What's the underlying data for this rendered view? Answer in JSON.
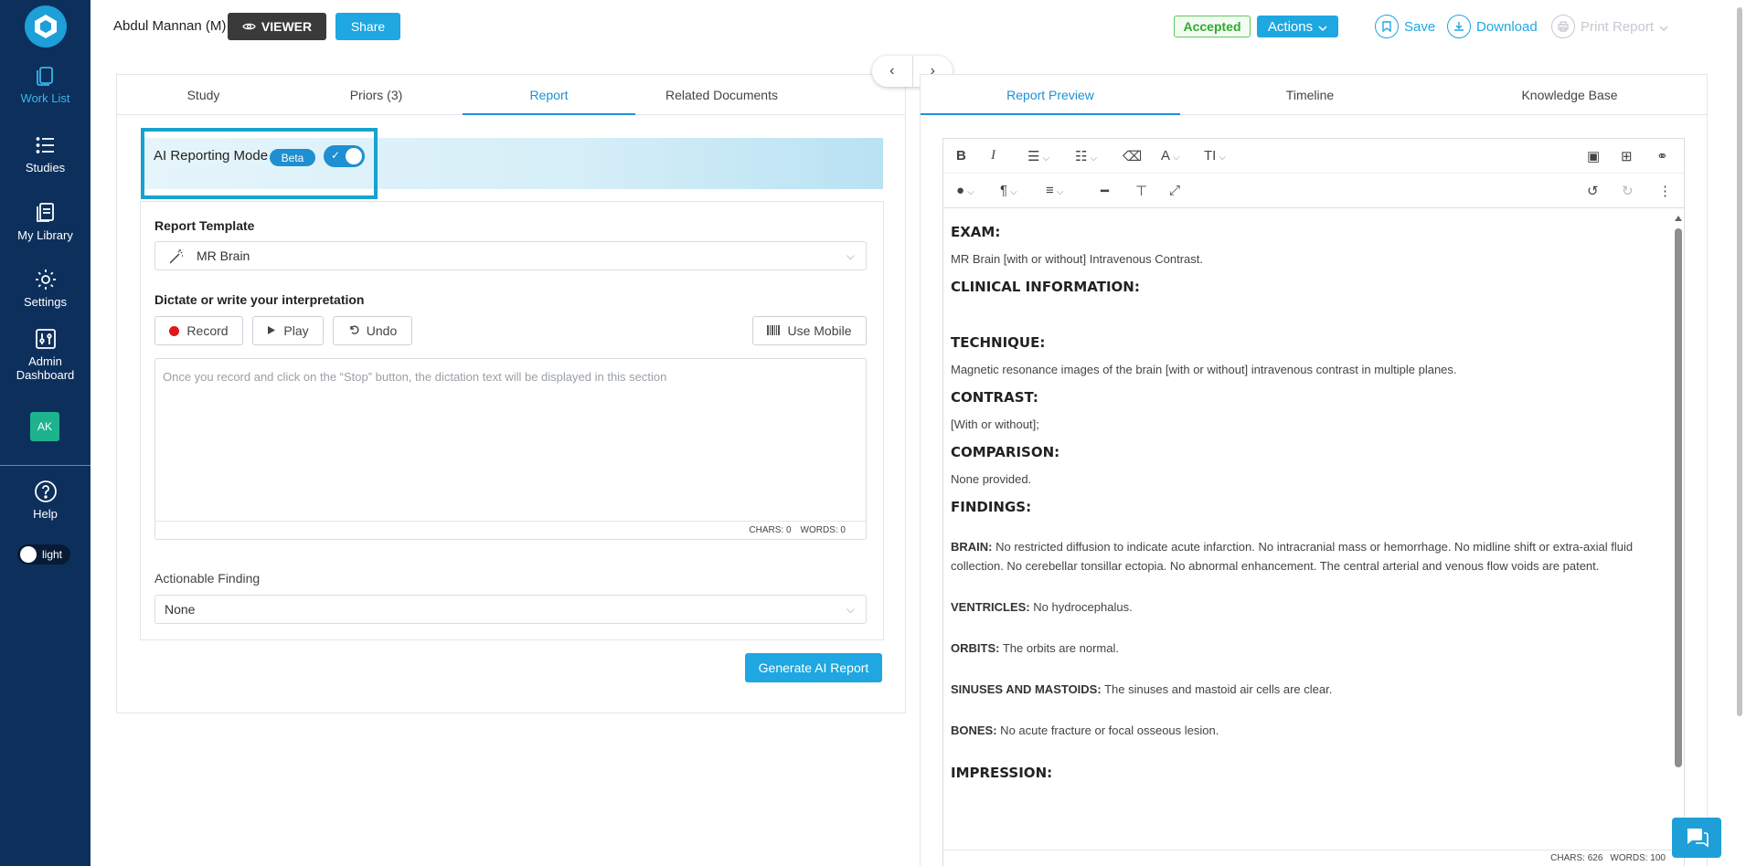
{
  "sidebar": {
    "items": [
      {
        "label": "Work List",
        "icon": "worklist-icon",
        "active": true
      },
      {
        "label": "Studies",
        "icon": "list-icon"
      },
      {
        "label": "My Library",
        "icon": "library-icon"
      },
      {
        "label": "Settings",
        "icon": "gear-icon"
      },
      {
        "label": "Admin Dashboard",
        "icon": "sliders-icon"
      }
    ],
    "avatar": "AK",
    "help": "Help",
    "theme": "light"
  },
  "header": {
    "patient": "Abdul Mannan (M)",
    "viewer": "VIEWER",
    "share": "Share",
    "status": "Accepted",
    "actions": "Actions",
    "save": "Save",
    "download": "Download",
    "print": "Print Report"
  },
  "left": {
    "tabs": [
      "Study",
      "Priors (3)",
      "Report",
      "Related Documents"
    ],
    "active_tab": "Report",
    "ai_label": "AI Reporting Mode",
    "beta": "Beta",
    "template_label": "Report Template",
    "template_value": "MR Brain",
    "dictate_label": "Dictate or write your interpretation",
    "record": "Record",
    "play": "Play",
    "undo": "Undo",
    "use_mobile": "Use Mobile",
    "placeholder": "Once you record and click on the “Stop” button, the dictation text will be displayed in this section",
    "chars": "CHARS: 0",
    "words": "WORDS: 0",
    "actionable_label": "Actionable Finding",
    "actionable_value": "None",
    "generate": "Generate AI Report"
  },
  "right": {
    "tabs": [
      "Report Preview",
      "Timeline",
      "Knowledge Base"
    ],
    "active_tab": "Report Preview",
    "report": {
      "exam_h": "EXAM:",
      "exam": "MR Brain [with or without] Intravenous Contrast.",
      "clinical_h": "CLINICAL INFORMATION:",
      "technique_h": "TECHNIQUE:",
      "technique": "Magnetic resonance images of the brain [with or without] intravenous contrast in multiple planes.",
      "contrast_h": "CONTRAST:",
      "contrast": "[With or without];",
      "comparison_h": "COMPARISON:",
      "comparison": "None provided.",
      "findings_h": "FINDINGS:",
      "brain_k": "BRAIN:",
      "brain": " No restricted diffusion to indicate acute infarction. No intracranial mass or hemorrhage. No midline shift or extra-axial fluid collection. No cerebellar tonsillar ectopia. No abnormal enhancement. The central arterial and venous flow voids are patent.",
      "ventricles_k": "VENTRICLES:",
      "ventricles": " No hydrocephalus.",
      "orbits_k": "ORBITS:",
      "orbits": " The orbits are normal.",
      "sinuses_k": "SINUSES AND MASTOIDS:",
      "sinuses": " The sinuses and mastoid air cells are clear.",
      "bones_k": "BONES:",
      "bones": " No acute fracture or focal osseous lesion.",
      "impression_h": "IMPRESSION:"
    },
    "chars": "CHARS: 626",
    "words": "WORDS: 100"
  },
  "colors": {
    "sidebar": "#0d2f5c",
    "accent": "#1ea7e1",
    "success": "#2eab2e"
  }
}
